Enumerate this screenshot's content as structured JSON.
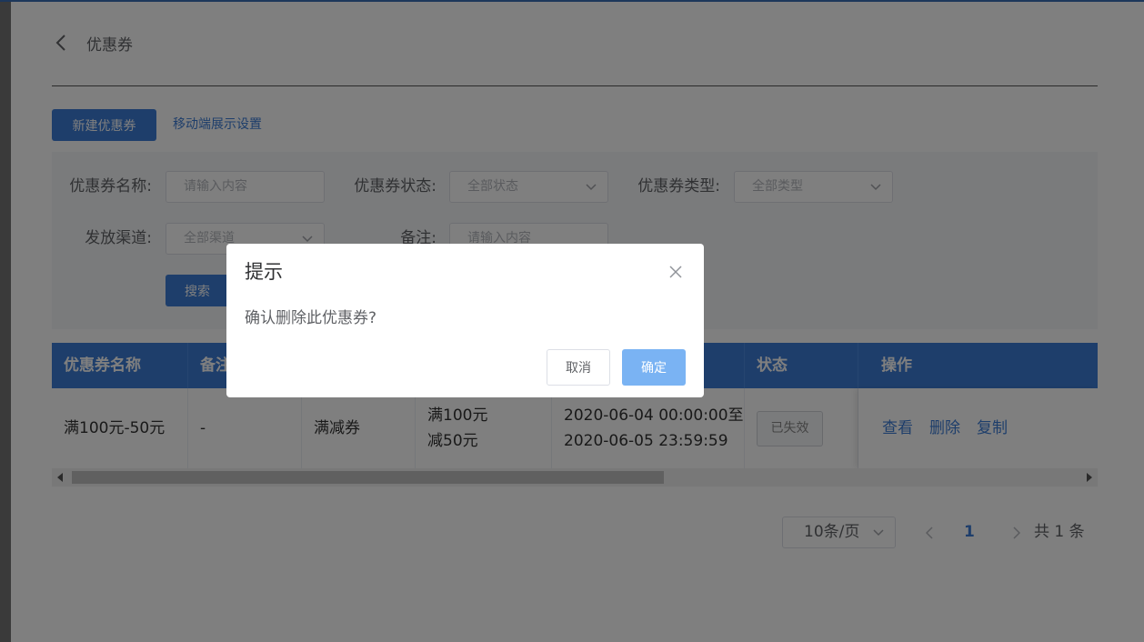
{
  "header": {
    "title": "优惠券"
  },
  "toolbar": {
    "new_label": "新建优惠券",
    "mobile_link": "移动端展示设置"
  },
  "filters": {
    "name_label": "优惠券名称:",
    "name_placeholder": "请输入内容",
    "status_label": "优惠券状态:",
    "status_value": "全部状态",
    "type_label": "优惠券类型:",
    "type_value": "全部类型",
    "channel_label": "发放渠道:",
    "channel_value": "全部渠道",
    "remark_label": "备注:",
    "remark_placeholder": "请输入内容",
    "search_label": "搜索"
  },
  "table": {
    "columns": [
      "优惠券名称",
      "备注",
      "",
      "",
      "",
      "状态",
      "操作"
    ],
    "rows": [
      {
        "name": "满100元-50元",
        "remark": "-",
        "type": "满减券",
        "rule_line1": "满100元",
        "rule_line2": "减50元",
        "period_line1": "2020-06-04 00:00:00至",
        "period_line2": "2020-06-05 23:59:59",
        "status": "已失效",
        "actions": [
          "查看",
          "删除",
          "复制"
        ]
      }
    ]
  },
  "pagination": {
    "page_size": "10条/页",
    "current_page": "1",
    "total": "共 1 条"
  },
  "dialog": {
    "title": "提示",
    "message": "确认删除此优惠券?",
    "cancel": "取消",
    "confirm": "确定"
  },
  "colors": {
    "primary": "#3d7dd6",
    "confirm_button": "#7ab3f3",
    "overlay": "rgba(0,0,0,0.5)"
  }
}
